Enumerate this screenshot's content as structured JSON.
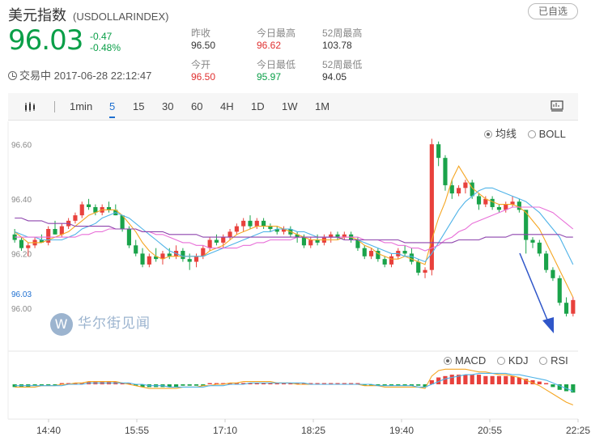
{
  "header": {
    "title": "美元指数",
    "code": "(USDOLLARINDEX)",
    "watch_label": "已自选",
    "price": "96.03",
    "change": "-0.47",
    "change_pct": "-0.48%",
    "status": "交易中 2017-06-28 22:12:47",
    "stats": {
      "prev_close_label": "昨收",
      "prev_close": "96.50",
      "day_high_label": "今日最高",
      "day_high": "96.62",
      "w52_high_label": "52周最高",
      "w52_high": "103.78",
      "open_label": "今开",
      "open": "96.50",
      "day_low_label": "今日最低",
      "day_low": "95.97",
      "w52_low_label": "52周最低",
      "w52_low": "94.05"
    }
  },
  "toolbar": {
    "periods": [
      "1min",
      "5",
      "15",
      "30",
      "60",
      "4H",
      "1D",
      "1W",
      "1M"
    ],
    "active_period": "5"
  },
  "legend_top": {
    "ma_label": "均线",
    "boll_label": "BOLL",
    "selected": "均线"
  },
  "legend_bottom": {
    "macd_label": "MACD",
    "kdj_label": "KDJ",
    "rsi_label": "RSI",
    "selected": "MACD"
  },
  "watermark": "华尔街见闻",
  "colors": {
    "up": "#e8413c",
    "down": "#1aa34a",
    "ma5": "#f5a623",
    "ma10": "#4fb3e8",
    "ma20": "#e86fd8",
    "ma30": "#8e44ad"
  },
  "chart_data": {
    "type": "candlestick",
    "ylim": [
      95.92,
      96.66
    ],
    "y_ticks": [
      "96.60",
      "96.40",
      "96.20",
      "96.00"
    ],
    "current_price_label": "96.03",
    "x_ticks": [
      "14:40",
      "15:55",
      "17:10",
      "18:25",
      "19:40",
      "20:55",
      "22:25"
    ],
    "candles": [
      [
        96.27,
        96.29,
        96.24,
        96.25
      ],
      [
        96.25,
        96.26,
        96.21,
        96.22
      ],
      [
        96.22,
        96.24,
        96.19,
        96.23
      ],
      [
        96.23,
        96.26,
        96.22,
        96.25
      ],
      [
        96.25,
        96.27,
        96.24,
        96.24
      ],
      [
        96.24,
        96.3,
        96.23,
        96.29
      ],
      [
        96.29,
        96.32,
        96.27,
        96.27
      ],
      [
        96.27,
        96.31,
        96.26,
        96.3
      ],
      [
        96.3,
        96.33,
        96.29,
        96.32
      ],
      [
        96.32,
        96.35,
        96.31,
        96.34
      ],
      [
        96.34,
        96.39,
        96.33,
        96.38
      ],
      [
        96.38,
        96.4,
        96.36,
        96.37
      ],
      [
        96.37,
        96.38,
        96.34,
        96.35
      ],
      [
        96.35,
        96.38,
        96.34,
        96.37
      ],
      [
        96.37,
        96.39,
        96.35,
        96.36
      ],
      [
        96.36,
        96.38,
        96.34,
        96.34
      ],
      [
        96.34,
        96.34,
        96.28,
        96.29
      ],
      [
        96.29,
        96.3,
        96.22,
        96.23
      ],
      [
        96.23,
        96.25,
        96.19,
        96.2
      ],
      [
        96.2,
        96.22,
        96.15,
        96.16
      ],
      [
        96.16,
        96.2,
        96.15,
        96.19
      ],
      [
        96.19,
        96.22,
        96.17,
        96.18
      ],
      [
        96.18,
        96.21,
        96.16,
        96.2
      ],
      [
        96.2,
        96.22,
        96.18,
        96.19
      ],
      [
        96.19,
        96.23,
        96.18,
        96.21
      ],
      [
        96.21,
        96.22,
        96.17,
        96.18
      ],
      [
        96.18,
        96.2,
        96.14,
        96.17
      ],
      [
        96.17,
        96.2,
        96.15,
        96.19
      ],
      [
        96.19,
        96.23,
        96.18,
        96.22
      ],
      [
        96.22,
        96.26,
        96.21,
        96.25
      ],
      [
        96.25,
        96.27,
        96.23,
        96.24
      ],
      [
        96.24,
        96.27,
        96.22,
        96.26
      ],
      [
        96.26,
        96.29,
        96.25,
        96.28
      ],
      [
        96.28,
        96.31,
        96.27,
        96.3
      ],
      [
        96.3,
        96.33,
        96.28,
        96.32
      ],
      [
        96.32,
        96.34,
        96.29,
        96.3
      ],
      [
        96.3,
        96.33,
        96.29,
        96.32
      ],
      [
        96.32,
        96.33,
        96.29,
        96.3
      ],
      [
        96.3,
        96.31,
        96.28,
        96.29
      ],
      [
        96.29,
        96.3,
        96.27,
        96.28
      ],
      [
        96.28,
        96.3,
        96.27,
        96.29
      ],
      [
        96.29,
        96.3,
        96.26,
        96.27
      ],
      [
        96.27,
        96.28,
        96.24,
        96.26
      ],
      [
        96.26,
        96.27,
        96.22,
        96.23
      ],
      [
        96.23,
        96.26,
        96.22,
        96.25
      ],
      [
        96.25,
        96.27,
        96.23,
        96.24
      ],
      [
        96.24,
        96.27,
        96.23,
        96.26
      ],
      [
        96.26,
        96.28,
        96.24,
        96.27
      ],
      [
        96.27,
        96.28,
        96.25,
        96.26
      ],
      [
        96.26,
        96.28,
        96.25,
        96.27
      ],
      [
        96.27,
        96.28,
        96.24,
        96.25
      ],
      [
        96.25,
        96.26,
        96.21,
        96.22
      ],
      [
        96.22,
        96.23,
        96.18,
        96.19
      ],
      [
        96.19,
        96.22,
        96.18,
        96.21
      ],
      [
        96.21,
        96.22,
        96.17,
        96.18
      ],
      [
        96.18,
        96.19,
        96.15,
        96.16
      ],
      [
        96.16,
        96.2,
        96.15,
        96.19
      ],
      [
        96.19,
        96.22,
        96.18,
        96.21
      ],
      [
        96.21,
        96.23,
        96.19,
        96.2
      ],
      [
        96.2,
        96.22,
        96.16,
        96.17
      ],
      [
        96.17,
        96.18,
        96.12,
        96.13
      ],
      [
        96.13,
        96.15,
        96.11,
        96.14
      ],
      [
        96.14,
        96.62,
        96.12,
        96.6
      ],
      [
        96.6,
        96.61,
        96.52,
        96.55
      ],
      [
        96.55,
        96.56,
        96.43,
        96.45
      ],
      [
        96.45,
        96.47,
        96.4,
        96.42
      ],
      [
        96.42,
        96.45,
        96.41,
        96.44
      ],
      [
        96.44,
        96.47,
        96.42,
        96.46
      ],
      [
        96.46,
        96.47,
        96.4,
        96.41
      ],
      [
        96.41,
        96.42,
        96.36,
        96.38
      ],
      [
        96.38,
        96.41,
        96.37,
        96.4
      ],
      [
        96.4,
        96.41,
        96.36,
        96.37
      ],
      [
        96.37,
        96.38,
        96.35,
        96.36
      ],
      [
        96.36,
        96.39,
        96.35,
        96.38
      ],
      [
        96.38,
        96.41,
        96.37,
        96.39
      ],
      [
        96.39,
        96.4,
        96.35,
        96.36
      ],
      [
        96.36,
        96.25,
        96.2,
        96.25
      ],
      [
        96.25,
        96.26,
        96.22,
        96.24
      ],
      [
        96.24,
        96.25,
        96.19,
        96.2
      ],
      [
        96.2,
        96.21,
        96.13,
        96.14
      ],
      [
        96.14,
        96.15,
        96.1,
        96.11
      ],
      [
        96.11,
        96.12,
        96.01,
        96.02
      ],
      [
        96.02,
        96.04,
        95.97,
        95.98
      ],
      [
        95.98,
        96.04,
        95.97,
        96.03
      ]
    ],
    "ma_lines": [
      {
        "name": "MA5",
        "values": [
          96.28,
          96.26,
          96.24,
          96.24,
          96.24,
          96.25,
          96.26,
          96.27,
          96.28,
          96.3,
          96.32,
          96.34,
          96.35,
          96.36,
          96.36,
          96.36,
          96.34,
          96.31,
          96.28,
          96.24,
          96.21,
          96.19,
          96.18,
          96.19,
          96.19,
          96.19,
          96.19,
          96.19,
          96.19,
          96.21,
          96.22,
          96.23,
          96.25,
          96.27,
          96.28,
          96.29,
          96.3,
          96.3,
          96.3,
          96.3,
          96.29,
          96.28,
          96.27,
          96.26,
          96.25,
          96.25,
          96.25,
          96.25,
          96.25,
          96.26,
          96.26,
          96.25,
          96.23,
          96.22,
          96.2,
          96.19,
          96.18,
          96.18,
          96.19,
          96.18,
          96.17,
          96.16,
          96.25,
          96.33,
          96.39,
          96.47,
          96.52,
          96.48,
          96.44,
          96.42,
          96.4,
          96.39,
          96.38,
          96.38,
          96.38,
          96.37,
          96.35,
          96.32,
          96.29,
          96.24,
          96.19,
          96.14,
          96.09,
          96.04
        ]
      },
      {
        "name": "MA10",
        "values": [
          96.28,
          96.27,
          96.26,
          96.26,
          96.25,
          96.25,
          96.25,
          96.25,
          96.26,
          96.27,
          96.29,
          96.3,
          96.31,
          96.33,
          96.34,
          96.35,
          96.34,
          96.33,
          96.31,
          96.29,
          96.27,
          96.25,
          96.23,
          96.21,
          96.2,
          96.19,
          96.19,
          96.19,
          96.19,
          96.2,
          96.21,
          96.22,
          96.23,
          96.24,
          96.25,
          96.26,
          96.27,
          96.28,
          96.28,
          96.29,
          96.29,
          96.29,
          96.28,
          96.28,
          96.27,
          96.26,
          96.26,
          96.26,
          96.26,
          96.25,
          96.25,
          96.25,
          96.24,
          96.23,
          96.22,
          96.21,
          96.2,
          96.2,
          96.19,
          96.19,
          96.18,
          96.17,
          96.2,
          96.24,
          96.28,
          96.32,
          96.36,
          96.39,
          96.41,
          96.43,
          96.44,
          96.44,
          96.43,
          96.42,
          96.41,
          96.4,
          96.39,
          96.37,
          96.35,
          96.32,
          96.29,
          96.26,
          96.21,
          96.16
        ]
      },
      {
        "name": "MA20",
        "values": [
          96.26,
          96.26,
          96.26,
          96.26,
          96.26,
          96.26,
          96.26,
          96.26,
          96.26,
          96.26,
          96.27,
          96.27,
          96.28,
          96.28,
          96.29,
          96.29,
          96.29,
          96.29,
          96.29,
          96.28,
          96.28,
          96.27,
          96.27,
          96.26,
          96.25,
          96.24,
          96.24,
          96.23,
          96.23,
          96.22,
          96.22,
          96.22,
          96.22,
          96.22,
          96.23,
          96.23,
          96.24,
          96.24,
          96.25,
          96.25,
          96.25,
          96.25,
          96.26,
          96.26,
          96.26,
          96.26,
          96.26,
          96.26,
          96.26,
          96.26,
          96.26,
          96.26,
          96.25,
          96.25,
          96.25,
          96.24,
          96.24,
          96.23,
          96.23,
          96.22,
          96.22,
          96.21,
          96.22,
          96.23,
          96.25,
          96.26,
          96.28,
          96.29,
          96.31,
          96.32,
          96.33,
          96.34,
          96.35,
          96.36,
          96.37,
          96.37,
          96.37,
          96.37,
          96.37,
          96.36,
          96.35,
          96.33,
          96.31,
          96.29
        ]
      },
      {
        "name": "MA30",
        "values": [
          96.33,
          96.33,
          96.32,
          96.32,
          96.32,
          96.31,
          96.31,
          96.31,
          96.31,
          96.3,
          96.3,
          96.3,
          96.3,
          96.3,
          96.3,
          96.29,
          96.29,
          96.29,
          96.29,
          96.28,
          96.28,
          96.28,
          96.28,
          96.27,
          96.27,
          96.27,
          96.27,
          96.27,
          96.26,
          96.26,
          96.26,
          96.26,
          96.26,
          96.26,
          96.26,
          96.26,
          96.26,
          96.26,
          96.26,
          96.26,
          96.26,
          96.26,
          96.26,
          96.26,
          96.26,
          96.26,
          96.26,
          96.26,
          96.26,
          96.25,
          96.25,
          96.25,
          96.25,
          96.25,
          96.25,
          96.25,
          96.25,
          96.25,
          96.24,
          96.24,
          96.24,
          96.24,
          96.24,
          96.24,
          96.24,
          96.24,
          96.25,
          96.25,
          96.25,
          96.25,
          96.26,
          96.26,
          96.26,
          96.26,
          96.27,
          96.27,
          96.27,
          96.27,
          96.27,
          96.27,
          96.27,
          96.27,
          96.26,
          96.26
        ]
      }
    ],
    "macd_hist": [
      -0.02,
      -0.02,
      -0.02,
      -0.01,
      -0.01,
      -0.01,
      -0.01,
      0.0,
      0.0,
      0.01,
      0.01,
      0.02,
      0.02,
      0.02,
      0.02,
      0.02,
      0.01,
      0.0,
      -0.01,
      -0.02,
      -0.02,
      -0.02,
      -0.02,
      -0.02,
      -0.02,
      -0.01,
      -0.01,
      -0.01,
      -0.01,
      0.0,
      0.0,
      0.0,
      0.01,
      0.01,
      0.01,
      0.01,
      0.01,
      0.01,
      0.01,
      0.01,
      0.0,
      0.0,
      0.0,
      0.0,
      0.0,
      0.0,
      0.0,
      0.0,
      0.0,
      0.0,
      0.0,
      0.0,
      -0.01,
      -0.01,
      -0.01,
      -0.01,
      -0.01,
      -0.01,
      -0.01,
      -0.01,
      -0.01,
      -0.02,
      0.03,
      0.05,
      0.06,
      0.07,
      0.07,
      0.07,
      0.07,
      0.07,
      0.06,
      0.06,
      0.06,
      0.06,
      0.06,
      0.05,
      0.04,
      0.03,
      0.02,
      0.0,
      -0.02,
      -0.04,
      -0.05,
      -0.06
    ],
    "macd_dif": [
      -0.02,
      -0.02,
      -0.02,
      -0.02,
      -0.01,
      -0.01,
      -0.01,
      0.0,
      0.0,
      0.01,
      0.01,
      0.02,
      0.02,
      0.02,
      0.02,
      0.02,
      0.01,
      0.0,
      -0.01,
      -0.02,
      -0.03,
      -0.03,
      -0.03,
      -0.03,
      -0.03,
      -0.02,
      -0.02,
      -0.02,
      -0.01,
      -0.01,
      0.0,
      0.0,
      0.01,
      0.01,
      0.02,
      0.02,
      0.02,
      0.02,
      0.02,
      0.01,
      0.01,
      0.01,
      0.0,
      0.0,
      0.0,
      0.0,
      0.0,
      0.0,
      0.0,
      0.0,
      0.0,
      0.0,
      -0.01,
      -0.01,
      -0.01,
      -0.02,
      -0.02,
      -0.02,
      -0.02,
      -0.02,
      -0.02,
      -0.03,
      0.06,
      0.1,
      0.11,
      0.11,
      0.11,
      0.11,
      0.1,
      0.09,
      0.09,
      0.08,
      0.07,
      0.07,
      0.06,
      0.05,
      0.03,
      0.01,
      -0.01,
      -0.04,
      -0.07,
      -0.1,
      -0.13,
      -0.15
    ],
    "macd_dea": [
      -0.01,
      -0.01,
      -0.01,
      -0.01,
      -0.01,
      -0.01,
      -0.01,
      -0.01,
      0.0,
      0.0,
      0.0,
      0.01,
      0.01,
      0.01,
      0.01,
      0.01,
      0.01,
      0.01,
      0.0,
      0.0,
      -0.01,
      -0.01,
      -0.01,
      -0.02,
      -0.02,
      -0.02,
      -0.02,
      -0.02,
      -0.02,
      -0.01,
      -0.01,
      -0.01,
      0.0,
      0.0,
      0.0,
      0.01,
      0.01,
      0.01,
      0.01,
      0.01,
      0.01,
      0.01,
      0.01,
      0.01,
      0.0,
      0.0,
      0.0,
      0.0,
      0.0,
      0.0,
      0.0,
      0.0,
      0.0,
      0.0,
      -0.01,
      -0.01,
      -0.01,
      -0.01,
      -0.01,
      -0.01,
      -0.02,
      -0.02,
      0.0,
      0.02,
      0.04,
      0.05,
      0.06,
      0.07,
      0.07,
      0.08,
      0.08,
      0.08,
      0.08,
      0.08,
      0.07,
      0.07,
      0.06,
      0.05,
      0.04,
      0.03,
      0.01,
      -0.01,
      -0.03,
      -0.05
    ]
  }
}
